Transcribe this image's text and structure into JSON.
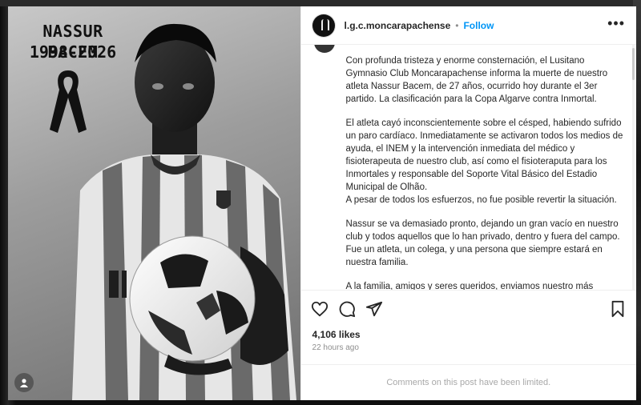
{
  "post": {
    "image": {
      "memorial_name": "NASSUR BACEM",
      "memorial_dates": "1998-2026",
      "icons": [
        "mourning-ribbon-icon",
        "user-tag-icon"
      ]
    },
    "header": {
      "username": "l.g.c.moncarapachense",
      "separator": "•",
      "follow_label": "Follow",
      "more_label": "•••"
    },
    "caption": {
      "paragraphs": [
        "Con profunda tristeza y enorme consternación, el Lusitano Gymnasio Club Moncarapachense informa la muerte de nuestro atleta Nassur Bacem, de 27 años, ocurrido hoy durante el 3er partido. La clasificación para la Copa Algarve contra Inmortal.",
        "El atleta cayó inconscientemente sobre el césped, habiendo sufrido un paro cardíaco. Inmediatamente se activaron todos los medios de ayuda, el INEM y la intervención inmediata del médico y fisioterapeuta de nuestro club, así como el fisioteraputa para los Inmortales y responsable del Soporte Vital Básico del Estadio Municipal de Olhão.",
        "A pesar de todos los esfuerzos, no fue posible revertir la situación.",
        "Nassur se va demasiado pronto, dejando un gran vacío en nuestro club y todos aquellos que lo han privado, dentro y fuera del campo. Fue un atleta, un colega, y una persona que siempre estará en nuestra familia.",
        "A la familia, amigos y seres queridos, enviamos nuestro más"
      ]
    },
    "actions": {
      "icons": [
        "heart-icon",
        "comment-icon",
        "share-icon",
        "save-icon"
      ]
    },
    "likes": "4,106 likes",
    "time": "22 hours ago",
    "comments_notice": "Comments on this post have been limited."
  }
}
